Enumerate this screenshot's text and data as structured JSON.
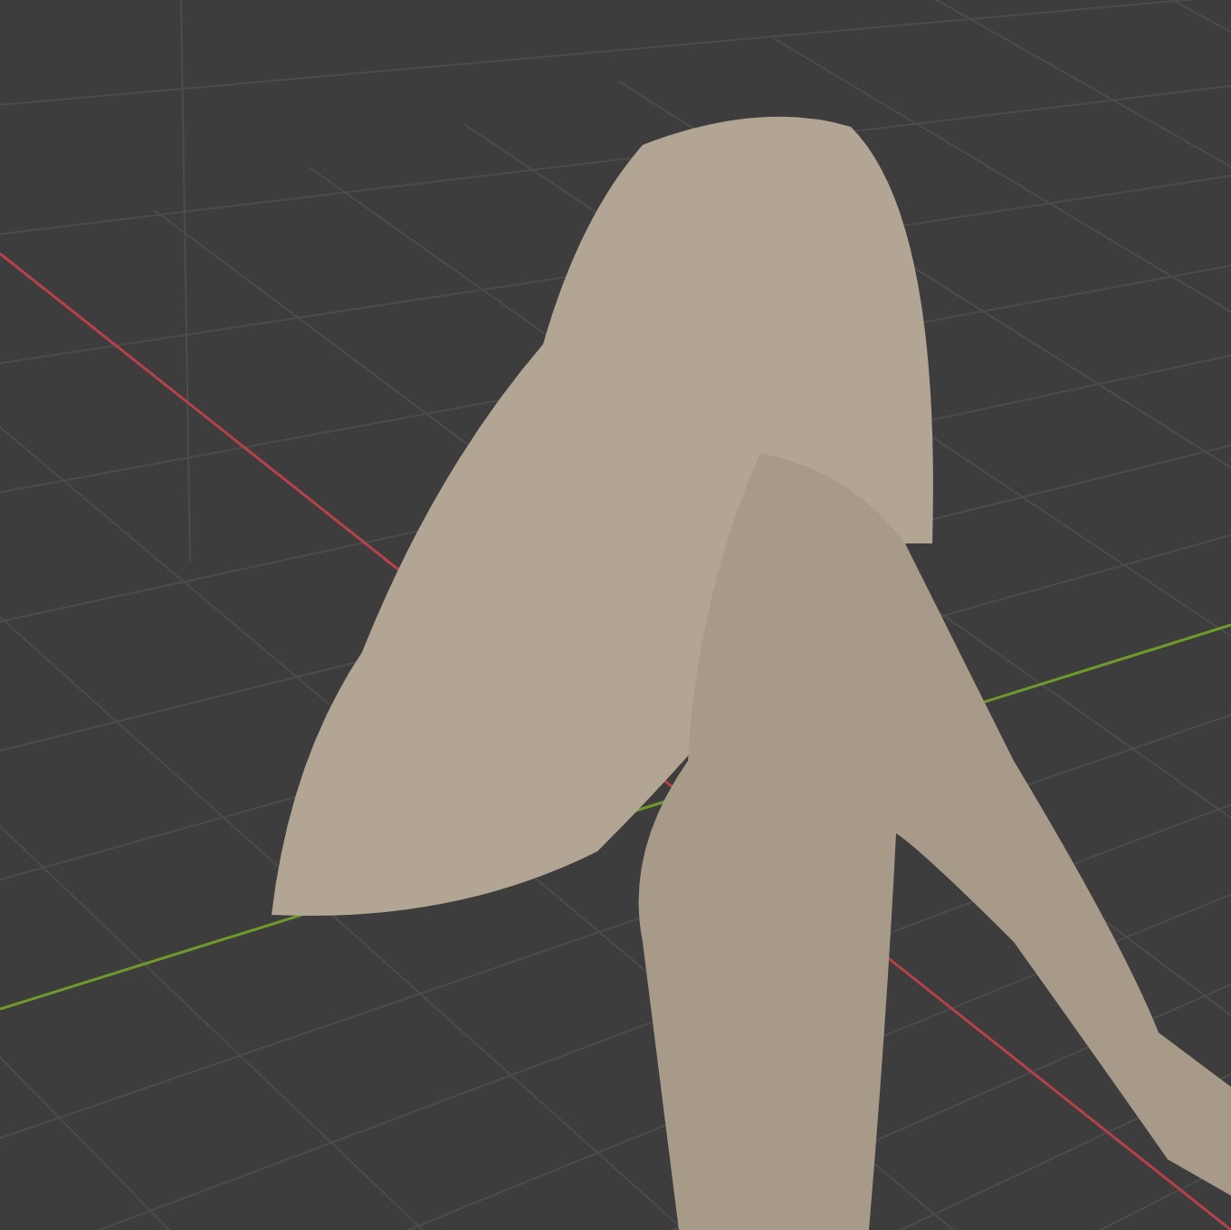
{
  "viewport": {
    "grid": true,
    "axes": [
      {
        "kind": "x",
        "color": "#b8404a"
      },
      {
        "kind": "y",
        "color": "#6f9a2a"
      }
    ],
    "model": {
      "kind": "sculpt"
    }
  }
}
